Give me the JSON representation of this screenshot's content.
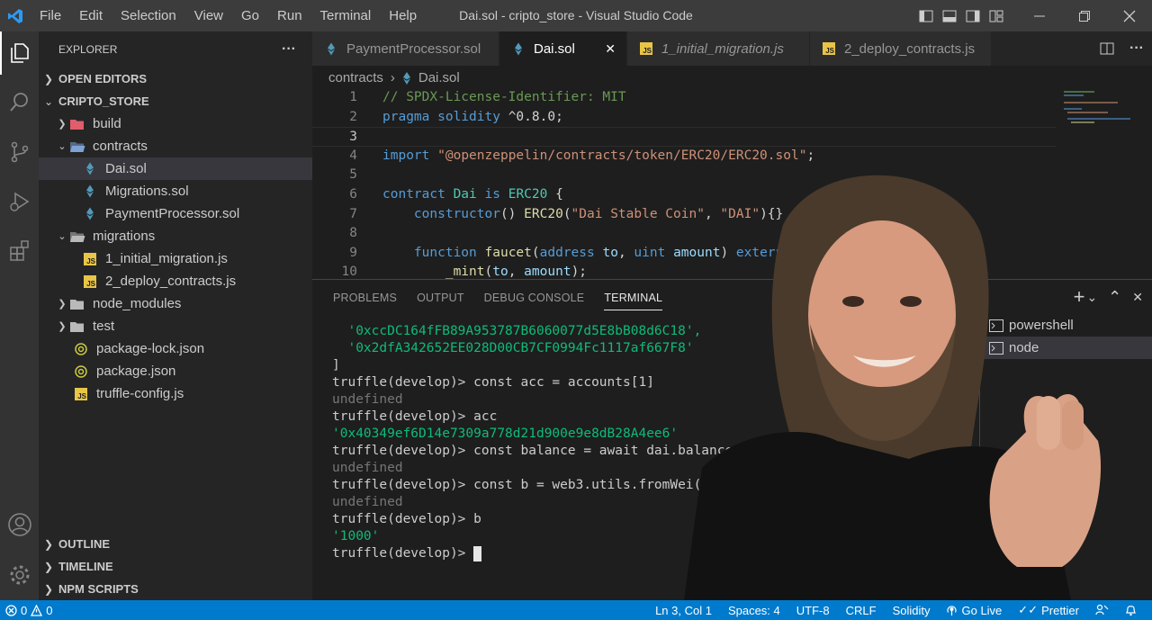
{
  "window": {
    "title": "Dai.sol - cripto_store - Visual Studio Code",
    "menu": [
      "File",
      "Edit",
      "Selection",
      "View",
      "Go",
      "Run",
      "Terminal",
      "Help"
    ]
  },
  "activity_bar": {
    "icons": [
      "files-icon",
      "search-icon",
      "source-control-icon",
      "run-debug-icon",
      "extensions-icon",
      "account-icon",
      "settings-gear-icon"
    ]
  },
  "sidebar": {
    "title": "EXPLORER",
    "more": "···",
    "open_editors": "OPEN EDITORS",
    "project": "CRIPTO_STORE",
    "tree": [
      {
        "label": "build",
        "kind": "folder",
        "expanded": false,
        "depth": 0
      },
      {
        "label": "contracts",
        "kind": "folder",
        "expanded": true,
        "depth": 0
      },
      {
        "label": "Dai.sol",
        "kind": "sol",
        "depth": 1,
        "selected": true
      },
      {
        "label": "Migrations.sol",
        "kind": "sol",
        "depth": 1
      },
      {
        "label": "PaymentProcessor.sol",
        "kind": "sol",
        "depth": 1
      },
      {
        "label": "migrations",
        "kind": "folder",
        "expanded": true,
        "depth": 0
      },
      {
        "label": "1_initial_migration.js",
        "kind": "js",
        "depth": 1
      },
      {
        "label": "2_deploy_contracts.js",
        "kind": "js",
        "depth": 1
      },
      {
        "label": "node_modules",
        "kind": "folder",
        "expanded": false,
        "depth": 0
      },
      {
        "label": "test",
        "kind": "folder",
        "expanded": false,
        "depth": 0
      },
      {
        "label": "package-lock.json",
        "kind": "json",
        "depth": 0
      },
      {
        "label": "package.json",
        "kind": "json",
        "depth": 0
      },
      {
        "label": "truffle-config.js",
        "kind": "js",
        "depth": 0
      }
    ],
    "outline": "OUTLINE",
    "timeline": "TIMELINE",
    "npm_scripts": "NPM SCRIPTS"
  },
  "tabs": [
    {
      "label": "PaymentProcessor.sol",
      "kind": "sol",
      "active": false,
      "italic": false
    },
    {
      "label": "Dai.sol",
      "kind": "sol",
      "active": true,
      "italic": false,
      "close": "✕"
    },
    {
      "label": "1_initial_migration.js",
      "kind": "js",
      "active": false,
      "italic": true
    },
    {
      "label": "2_deploy_contracts.js",
      "kind": "js",
      "active": false,
      "italic": false
    }
  ],
  "breadcrumb": {
    "folder": "contracts",
    "sep": "›",
    "file": "Dai.sol"
  },
  "code": {
    "current_line": 3,
    "lines": [
      {
        "n": "1",
        "tokens": [
          {
            "t": "// SPDX-License-Identifier: MIT",
            "c": "com"
          }
        ]
      },
      {
        "n": "2",
        "tokens": [
          {
            "t": "pragma",
            "c": "kw"
          },
          {
            "t": " ",
            "c": "pl"
          },
          {
            "t": "solidity",
            "c": "kw"
          },
          {
            "t": " ^0.8.0;",
            "c": "pl"
          }
        ]
      },
      {
        "n": "3",
        "tokens": []
      },
      {
        "n": "4",
        "tokens": [
          {
            "t": "import",
            "c": "kw"
          },
          {
            "t": " ",
            "c": "pl"
          },
          {
            "t": "\"@openzeppelin/contracts/token/ERC20/ERC20.sol\"",
            "c": "str"
          },
          {
            "t": ";",
            "c": "pl"
          }
        ]
      },
      {
        "n": "5",
        "tokens": []
      },
      {
        "n": "6",
        "tokens": [
          {
            "t": "contract",
            "c": "kw"
          },
          {
            "t": " ",
            "c": "pl"
          },
          {
            "t": "Dai",
            "c": "ty"
          },
          {
            "t": " ",
            "c": "pl"
          },
          {
            "t": "is",
            "c": "kw"
          },
          {
            "t": " ",
            "c": "pl"
          },
          {
            "t": "ERC20",
            "c": "ty"
          },
          {
            "t": " {",
            "c": "pl"
          }
        ]
      },
      {
        "n": "7",
        "tokens": [
          {
            "t": "    ",
            "c": "pl"
          },
          {
            "t": "constructor",
            "c": "kw"
          },
          {
            "t": "() ",
            "c": "pl"
          },
          {
            "t": "ERC20",
            "c": "fn"
          },
          {
            "t": "(",
            "c": "pl"
          },
          {
            "t": "\"Dai Stable Coin\"",
            "c": "str"
          },
          {
            "t": ", ",
            "c": "pl"
          },
          {
            "t": "\"DAI\"",
            "c": "str"
          },
          {
            "t": "){}",
            "c": "pl"
          }
        ]
      },
      {
        "n": "8",
        "tokens": []
      },
      {
        "n": "9",
        "tokens": [
          {
            "t": "    ",
            "c": "pl"
          },
          {
            "t": "function",
            "c": "kw"
          },
          {
            "t": " ",
            "c": "pl"
          },
          {
            "t": "faucet",
            "c": "fn"
          },
          {
            "t": "(",
            "c": "pl"
          },
          {
            "t": "address",
            "c": "kw"
          },
          {
            "t": " ",
            "c": "pl"
          },
          {
            "t": "to",
            "c": "var"
          },
          {
            "t": ", ",
            "c": "pl"
          },
          {
            "t": "uint",
            "c": "kw"
          },
          {
            "t": " ",
            "c": "pl"
          },
          {
            "t": "amount",
            "c": "var"
          },
          {
            "t": ") ",
            "c": "pl"
          },
          {
            "t": "extern",
            "c": "kw"
          }
        ]
      },
      {
        "n": "10",
        "tokens": [
          {
            "t": "        ",
            "c": "pl"
          },
          {
            "t": "_mint",
            "c": "fn"
          },
          {
            "t": "(",
            "c": "pl"
          },
          {
            "t": "to",
            "c": "var"
          },
          {
            "t": ", ",
            "c": "pl"
          },
          {
            "t": "amount",
            "c": "var"
          },
          {
            "t": ");",
            "c": "pl"
          }
        ]
      }
    ]
  },
  "panel": {
    "tabs": [
      "PROBLEMS",
      "OUTPUT",
      "DEBUG CONSOLE",
      "TERMINAL"
    ],
    "active_tab": "TERMINAL",
    "actions": {
      "add": "+",
      "dropdown": "⌄",
      "maximize": "⌃",
      "close": "✕"
    },
    "terminal_lines": [
      {
        "t": "  '0xccDC164fFB89A953787B6060077d5E8bB08d6C18',",
        "c": "green"
      },
      {
        "t": "  '0x2dfA342652EE028D00CB7CF0994Fc1117af667F8'",
        "c": "green"
      },
      {
        "t": "]",
        "c": "plain"
      },
      {
        "t": "truffle(develop)> const acc = accounts[1]",
        "c": "plain"
      },
      {
        "t": "undefined",
        "c": "grey"
      },
      {
        "t": "truffle(develop)> acc",
        "c": "plain"
      },
      {
        "t": "'0x40349ef6D14e7309a778d21d900e9e8dB28A4ee6'",
        "c": "green"
      },
      {
        "t": "truffle(develop)> const balance = await dai.balanceOf(",
        "c": "plain"
      },
      {
        "t": "undefined",
        "c": "grey"
      },
      {
        "t": "truffle(develop)> const b = web3.utils.fromWei(bal",
        "c": "plain"
      },
      {
        "t": "undefined",
        "c": "grey"
      },
      {
        "t": "truffle(develop)> b",
        "c": "plain"
      },
      {
        "t": "'1000'",
        "c": "green"
      }
    ],
    "prompt": "truffle(develop)> ",
    "terminals": [
      {
        "label": "powershell",
        "active": false
      },
      {
        "label": "node",
        "active": true
      }
    ]
  },
  "status": {
    "errors": "0",
    "warnings": "0",
    "position": "Ln 3, Col 1",
    "spaces": "Spaces: 4",
    "encoding": "UTF-8",
    "eol": "CRLF",
    "language": "Solidity",
    "golive": "Go Live",
    "prettier": "Prettier"
  },
  "colors": {
    "accent": "#007acc",
    "sol_icon": "#519aba",
    "js_icon": "#e8c547",
    "json_icon": "#cbcb41",
    "folder_build": "#e05d6c",
    "folder_blue": "#7fa2d4"
  }
}
